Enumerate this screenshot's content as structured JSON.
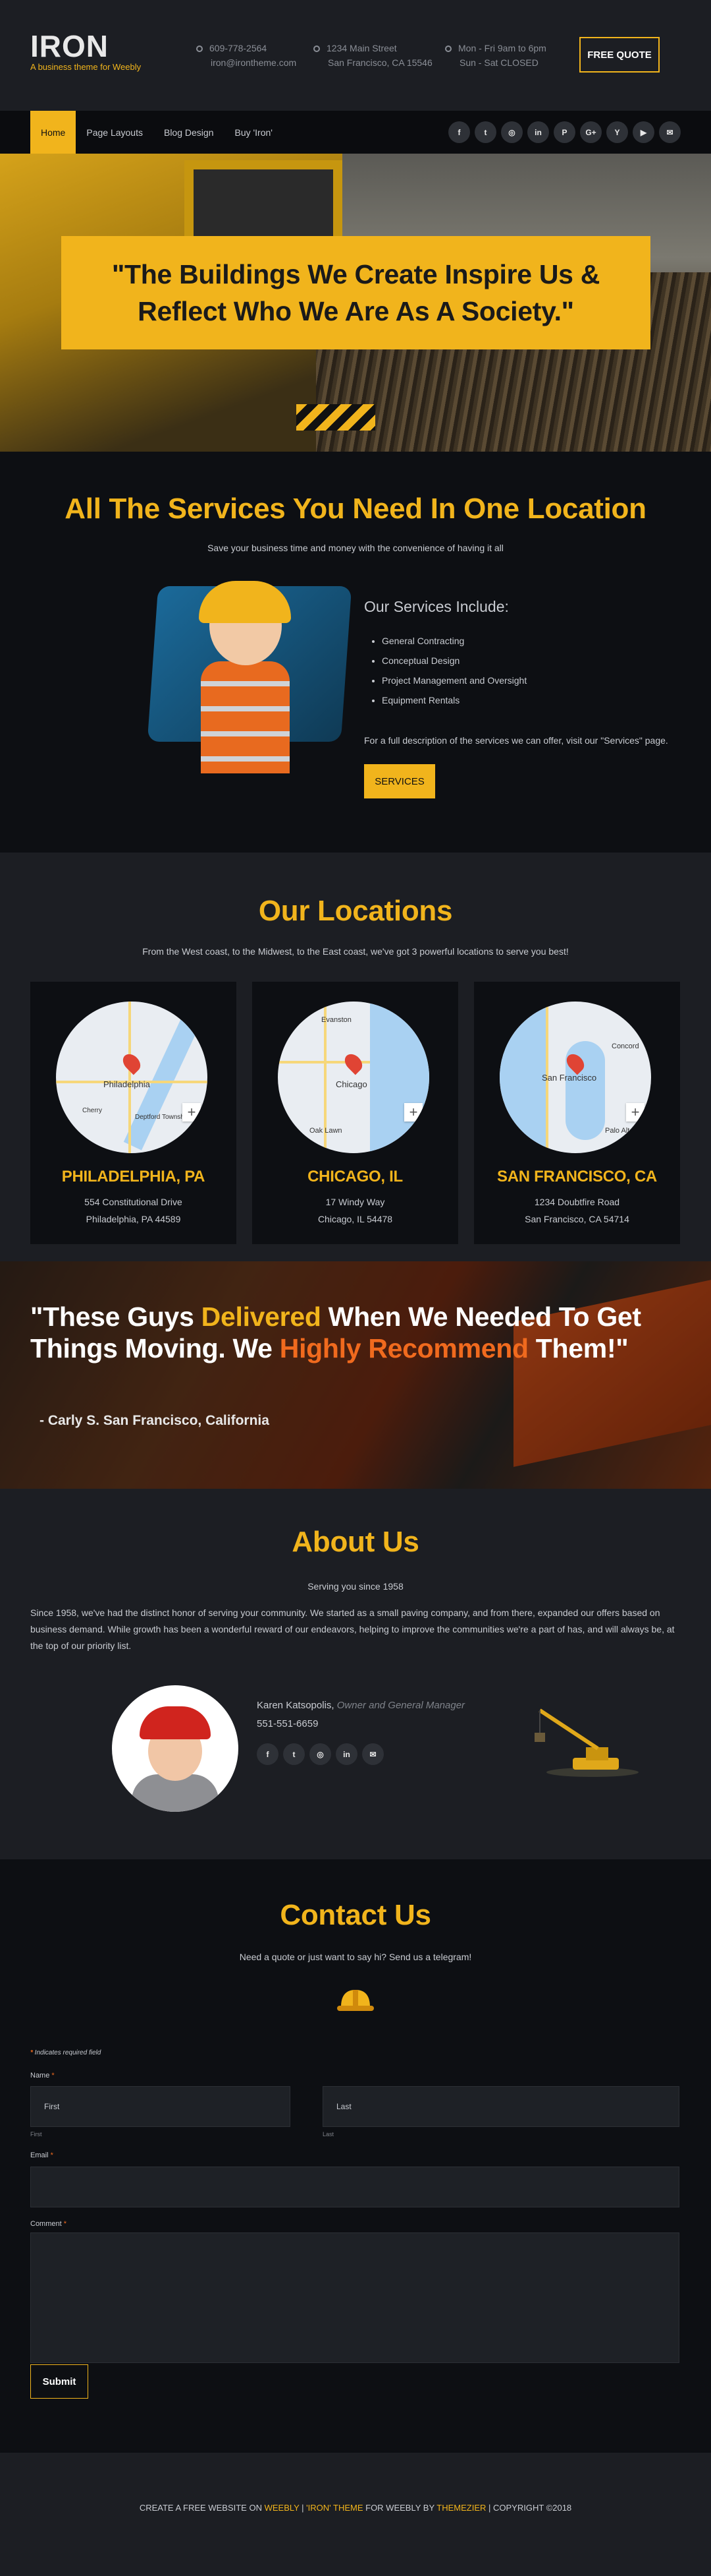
{
  "header": {
    "logo_title": "IRON",
    "logo_subtitle": "A business theme for Weebly",
    "phone": "609-778-2564",
    "email": "iron@irontheme.com",
    "address_line1": "1234 Main Street",
    "address_line2": "San Francisco, CA 15546",
    "hours_line1": "Mon - Fri 9am to 6pm",
    "hours_line2": "Sun - Sat CLOSED",
    "quote_button": "FREE QUOTE"
  },
  "nav": {
    "items": [
      {
        "label": "Home"
      },
      {
        "label": "Page Layouts"
      },
      {
        "label": "Blog Design"
      },
      {
        "label": "Buy 'Iron'"
      }
    ],
    "social": [
      {
        "icon": "facebook-icon",
        "glyph": "f"
      },
      {
        "icon": "twitter-icon",
        "glyph": "t"
      },
      {
        "icon": "instagram-icon",
        "glyph": "◎"
      },
      {
        "icon": "linkedin-icon",
        "glyph": "in"
      },
      {
        "icon": "pinterest-icon",
        "glyph": "P"
      },
      {
        "icon": "google-plus-icon",
        "glyph": "G+"
      },
      {
        "icon": "yelp-icon",
        "glyph": "Y"
      },
      {
        "icon": "youtube-icon",
        "glyph": "▶"
      },
      {
        "icon": "mail-icon",
        "glyph": "✉"
      }
    ]
  },
  "hero": {
    "quote": "\"The Buildings We Create Inspire Us & Reflect Who We Are As A Society.\""
  },
  "services": {
    "title": "All The Services You Need In One Location",
    "subtitle": "Save your business time and money with the convenience of having it all",
    "list_heading": "Our Services Include:",
    "items": [
      "General Contracting",
      "Conceptual Design",
      "Project Management and Oversight",
      "Equipment Rentals"
    ],
    "note": "For a full description of the services we can offer, visit our \"Services\" page.",
    "button": "SERVICES"
  },
  "locations": {
    "title": "Our Locations",
    "subtitle": "From the West coast, to the Midwest, to the East coast, we've got 3 powerful locations to serve you best!",
    "cards": [
      {
        "name": "PHILADELPHIA, PA",
        "line1": "554 Constitutional Drive",
        "line2": "Philadelphia, PA 44589",
        "map_label": "Philadelphia",
        "map_label2": "Deptford Township",
        "map_label3": "Cherry"
      },
      {
        "name": "CHICAGO, IL",
        "line1": "17 Windy Way",
        "line2": "Chicago, IL 54478",
        "map_label": "Chicago",
        "map_label2": "Evanston",
        "map_label3": "Oak Lawn"
      },
      {
        "name": "SAN FRANCISCO, CA",
        "line1": "1234 Doubtfire Road",
        "line2": "San Francisco, CA 54714",
        "map_label": "San Francisco",
        "map_label2": "Concord",
        "map_label3": "Palo Alt"
      }
    ],
    "zoom_symbol": "+"
  },
  "testimonial": {
    "q1": "\"These Guys ",
    "q2": "Delivered",
    "q3": " When We Needed To Get Things Moving. We ",
    "q4": "Highly Recommend",
    "q5": " Them!\"",
    "author": "- Carly S. San Francisco, California"
  },
  "about": {
    "title": "About Us",
    "subtitle": "Serving you since 1958",
    "text": "Since 1958, we've had the distinct honor of serving your community. We started as a small paving company, and from there, expanded our offers based on business demand. While growth has been a wonderful reward of our endeavors, helping to improve the communities we're a part of has, and will always be, at the top of our priority list.",
    "person_name": "Karen Katsopolis, ",
    "person_role": "Owner and General Manager",
    "person_phone": "551-551-6659",
    "social": [
      {
        "icon": "facebook-icon",
        "glyph": "f"
      },
      {
        "icon": "twitter-icon",
        "glyph": "t"
      },
      {
        "icon": "instagram-icon",
        "glyph": "◎"
      },
      {
        "icon": "linkedin-icon",
        "glyph": "in"
      },
      {
        "icon": "mail-icon",
        "glyph": "✉"
      }
    ]
  },
  "contact": {
    "title": "Contact Us",
    "subtitle": "Need a quote or just want to say hi? Send us a telegram!",
    "required_note": " Indicates required field",
    "required_star": "*",
    "name_label": "Name ",
    "first_placeholder": "First",
    "last_placeholder": "Last",
    "first_sub": "First",
    "last_sub": "Last",
    "email_label": "Email ",
    "comment_label": "Comment ",
    "submit": "Submit"
  },
  "footer": {
    "p1": "CREATE A FREE WEBSITE ON ",
    "p2": "WEEBLY",
    "p3": "  |  ",
    "p4": "'IRON' THEME",
    "p5": " FOR WEEBLY BY ",
    "p6": "THEMEZIER",
    "p7": "  |  COPYRIGHT ©2018"
  },
  "colors": {
    "accent": "#f1b41c",
    "background": "#0d0f13",
    "panel": "#1c1e23",
    "highlight": "#f06a1e"
  }
}
